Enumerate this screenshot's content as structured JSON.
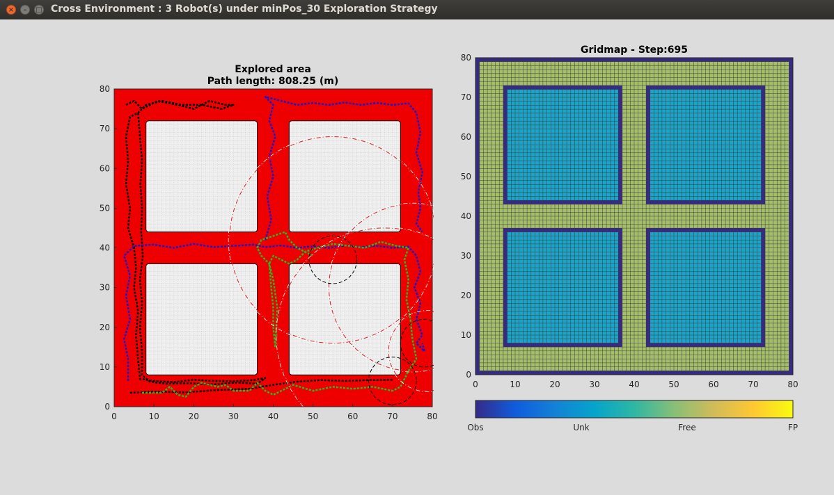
{
  "window": {
    "title": "Cross Environment : 3 Robot(s) under minPos_30 Exploration Strategy",
    "close_glyph": "×",
    "minimize_glyph": "–",
    "maximize_glyph": "□"
  },
  "colors": {
    "background": "#dcdcdc",
    "explored": "#ee0000",
    "unexplored_block": "#efefef",
    "robot1_path": "#000000",
    "robot2_path": "#1414d2",
    "robot3_path": "#22bb22",
    "sensor_circle": "#dd2222",
    "obs": "#352a87",
    "unk": "#1ba4c8",
    "free": "#a5be6a",
    "fp": "#f9fb0e"
  },
  "chart_data": [
    {
      "type": "scatter",
      "title": "Explored area",
      "subtitle": "Path length: 808.25 (m)",
      "xlim": [
        0,
        80
      ],
      "ylim": [
        0,
        80
      ],
      "xticks": [
        0,
        10,
        20,
        30,
        40,
        50,
        60,
        70,
        80
      ],
      "yticks": [
        0,
        10,
        20,
        30,
        40,
        50,
        60,
        70,
        80
      ],
      "grid": true,
      "blocks": [
        {
          "x0": 8,
          "x1": 36,
          "y0": 44,
          "y1": 72
        },
        {
          "x0": 44,
          "x1": 72,
          "y0": 44,
          "y1": 72
        },
        {
          "x0": 8,
          "x1": 36,
          "y0": 8,
          "y1": 36
        },
        {
          "x0": 44,
          "x1": 72,
          "y0": 8,
          "y1": 36
        }
      ],
      "series": [
        {
          "color": "robot1_path",
          "points": [
            [
              3,
              76
            ],
            [
              5,
              77
            ],
            [
              7,
              75
            ],
            [
              11,
              77
            ],
            [
              16,
              76
            ],
            [
              20,
              75
            ],
            [
              24,
              77
            ],
            [
              28,
              76
            ],
            [
              30,
              76
            ],
            [
              27,
              75
            ],
            [
              22,
              76
            ],
            [
              17,
              76
            ],
            [
              12,
              77
            ],
            [
              8,
              76
            ],
            [
              6,
              74
            ],
            [
              4,
              73
            ],
            [
              3,
              68
            ],
            [
              3.5,
              62
            ],
            [
              3,
              56
            ],
            [
              4,
              50
            ],
            [
              3.5,
              45
            ],
            [
              5,
              40
            ],
            [
              5.5,
              35
            ],
            [
              5,
              30
            ],
            [
              6,
              24
            ],
            [
              5.5,
              18
            ],
            [
              6,
              12
            ],
            [
              6.5,
              7
            ],
            [
              10,
              6.5
            ],
            [
              15,
              6.2
            ],
            [
              20,
              6.8
            ],
            [
              25,
              6.5
            ],
            [
              30,
              6.4
            ],
            [
              35,
              6.7
            ],
            [
              38,
              7.2
            ],
            [
              36,
              5.8
            ],
            [
              31,
              6.1
            ],
            [
              25,
              5.6
            ],
            [
              19,
              5.9
            ],
            [
              13,
              5.8
            ],
            [
              9,
              6.3
            ],
            [
              7,
              8
            ],
            [
              7,
              14
            ],
            [
              6.5,
              20
            ],
            [
              7,
              26
            ],
            [
              6.5,
              32
            ],
            [
              7.2,
              38
            ],
            [
              6.8,
              44
            ],
            [
              7,
              50
            ],
            [
              6.6,
              56
            ],
            [
              7,
              62
            ],
            [
              6.5,
              68
            ],
            [
              6,
              74
            ]
          ]
        },
        {
          "color": "robot1_path",
          "points": [
            [
              4,
              3.5
            ],
            [
              10,
              3.8
            ],
            [
              18,
              3.6
            ],
            [
              26,
              4.2
            ],
            [
              34,
              4.5
            ],
            [
              40,
              5.5
            ],
            [
              46,
              6.3
            ],
            [
              52,
              6.7
            ],
            [
              58,
              6.5
            ],
            [
              64,
              6.7
            ],
            [
              70,
              6.8
            ]
          ]
        },
        {
          "color": "robot2_path",
          "points": [
            [
              3.5,
              6.5
            ],
            [
              3.5,
              12
            ],
            [
              2.5,
              17
            ],
            [
              4,
              22
            ],
            [
              3,
              28
            ],
            [
              4,
              33
            ],
            [
              2.5,
              38
            ],
            [
              5,
              40.5
            ],
            [
              10,
              40.8
            ],
            [
              15,
              40
            ],
            [
              20,
              41
            ],
            [
              25,
              40.2
            ],
            [
              30,
              40.5
            ],
            [
              35,
              40.8
            ],
            [
              38,
              40.2
            ],
            [
              42,
              40.6
            ],
            [
              46,
              40
            ],
            [
              50,
              40.4
            ],
            [
              54,
              40
            ],
            [
              58,
              40.6
            ],
            [
              62,
              40.2
            ],
            [
              66,
              40.5
            ],
            [
              70,
              40
            ],
            [
              74,
              40.3
            ],
            [
              76,
              38
            ],
            [
              77,
              34
            ],
            [
              75.5,
              30
            ],
            [
              77,
              26
            ],
            [
              76,
              22
            ],
            [
              77.5,
              18
            ],
            [
              76,
              16
            ],
            [
              78,
              14
            ],
            [
              77.5,
              16
            ]
          ]
        },
        {
          "color": "robot2_path",
          "points": [
            [
              38,
              42
            ],
            [
              39.5,
              47
            ],
            [
              38.5,
              53
            ],
            [
              40,
              58
            ],
            [
              39,
              63
            ],
            [
              40.5,
              68
            ],
            [
              39,
              72
            ],
            [
              40,
              76
            ],
            [
              38,
              78
            ],
            [
              42,
              77
            ],
            [
              46,
              76
            ],
            [
              50,
              76.5
            ],
            [
              54,
              76
            ],
            [
              58,
              76.6
            ],
            [
              62,
              76
            ],
            [
              66,
              76.5
            ],
            [
              70,
              76
            ],
            [
              74,
              76.4
            ],
            [
              76,
              74
            ],
            [
              77,
              69
            ],
            [
              76,
              64
            ],
            [
              77.5,
              59
            ],
            [
              76.5,
              54
            ],
            [
              77,
              50
            ],
            [
              76,
              46
            ],
            [
              77.5,
              44
            ]
          ]
        },
        {
          "color": "robot3_path",
          "points": [
            [
              7,
              3.5
            ],
            [
              12,
              3.5
            ],
            [
              14,
              5
            ],
            [
              16,
              3
            ],
            [
              18,
              2.5
            ],
            [
              20,
              5
            ],
            [
              22,
              6
            ],
            [
              26,
              5
            ],
            [
              28,
              5.5
            ],
            [
              30,
              4
            ],
            [
              34,
              4
            ],
            [
              36,
              6
            ],
            [
              38,
              4
            ],
            [
              40,
              3
            ],
            [
              45,
              5.5
            ],
            [
              50,
              4
            ],
            [
              55,
              5
            ],
            [
              60,
              4.5
            ],
            [
              65,
              5
            ],
            [
              70,
              4
            ],
            [
              72,
              5
            ],
            [
              74,
              9
            ],
            [
              76,
              12
            ],
            [
              75,
              17
            ],
            [
              74.5,
              22
            ],
            [
              73.5,
              27
            ],
            [
              74,
              32
            ],
            [
              73,
              37
            ],
            [
              74,
              40
            ],
            [
              71,
              40.5
            ],
            [
              67,
              41.5
            ],
            [
              63,
              40
            ],
            [
              59,
              40.5
            ],
            [
              55,
              41
            ],
            [
              51,
              40
            ],
            [
              48,
              39
            ],
            [
              46,
              37
            ],
            [
              44,
              36
            ],
            [
              42,
              37
            ],
            [
              40,
              38
            ],
            [
              39,
              36
            ],
            [
              39.5,
              30
            ],
            [
              40,
              25
            ],
            [
              40,
              20
            ],
            [
              40.5,
              15
            ]
          ]
        },
        {
          "color": "robot3_path",
          "points": [
            [
              40.5,
              15
            ],
            [
              41,
              25
            ],
            [
              40,
              32
            ],
            [
              39,
              36
            ],
            [
              37,
              38
            ],
            [
              36,
              40
            ],
            [
              37,
              42
            ],
            [
              40,
              43
            ],
            [
              43,
              44
            ],
            [
              44,
              42
            ],
            [
              46,
              40
            ],
            [
              48,
              39
            ],
            [
              50,
              38
            ]
          ]
        }
      ],
      "sensor_circles": [
        {
          "cx": 55,
          "cy": 42,
          "r": 26
        },
        {
          "cx": 75,
          "cy": 30,
          "r": 21
        },
        {
          "cx": 68,
          "cy": 18,
          "r": 27
        },
        {
          "cx": 79,
          "cy": 14,
          "r": 10
        }
      ],
      "robot_circles": [
        {
          "cx": 55,
          "cy": 37,
          "r": 6
        },
        {
          "cx": 78,
          "cy": 16,
          "r": 6
        },
        {
          "cx": 70,
          "cy": 6.5,
          "r": 6
        }
      ]
    },
    {
      "type": "heatmap",
      "title": "Gridmap - Step:695",
      "xlim": [
        0,
        80
      ],
      "ylim": [
        0,
        80
      ],
      "xticks": [
        0,
        10,
        20,
        30,
        40,
        50,
        60,
        70,
        80
      ],
      "yticks": [
        0,
        10,
        20,
        30,
        40,
        50,
        60,
        70,
        80
      ],
      "grid_size": 80,
      "cells": {
        "border": "Obs",
        "outside_blocks": "Free",
        "block_edges": "Obs",
        "block_interiors": "Unk"
      },
      "colorbar": {
        "labels": [
          "Obs",
          "Unk",
          "Free",
          "FP"
        ],
        "colors": [
          "#352a87",
          "#0f5cdd",
          "#1481d6",
          "#06a4ca",
          "#2eb7a4",
          "#87bf77",
          "#d1bb59",
          "#fec832",
          "#f9fb0e"
        ]
      }
    }
  ]
}
